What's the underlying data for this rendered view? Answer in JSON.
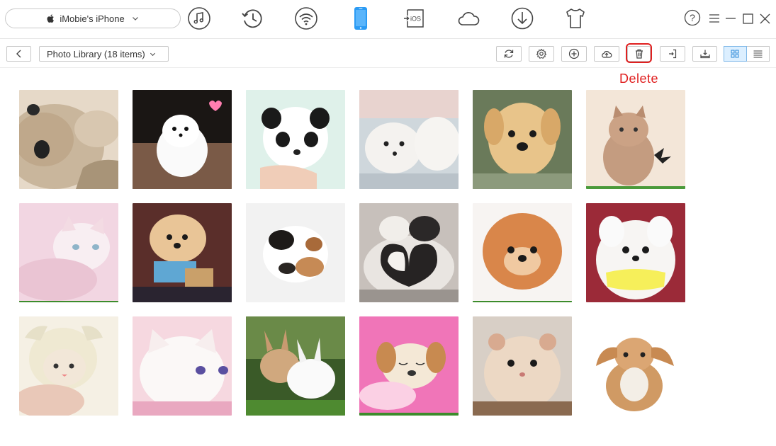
{
  "device": {
    "name": "iMobie's iPhone"
  },
  "nav": [
    {
      "id": "music",
      "icon": "music-icon"
    },
    {
      "id": "history",
      "icon": "history-icon"
    },
    {
      "id": "wifi",
      "icon": "wifi-icon"
    },
    {
      "id": "phone",
      "icon": "phone-icon",
      "active": true
    },
    {
      "id": "ios",
      "icon": "ios-transfer-icon",
      "label": "iOS"
    },
    {
      "id": "cloud",
      "icon": "cloud-icon"
    },
    {
      "id": "download",
      "icon": "download-icon"
    },
    {
      "id": "tshirt",
      "icon": "tshirt-icon"
    }
  ],
  "window": {
    "help": "?",
    "menu": "menu-icon",
    "minimize": "minimize-icon",
    "maximize": "maximize-icon",
    "close": "close-icon"
  },
  "toolbar": {
    "library_label": "Photo Library (18 items)",
    "delete_annotation": "Delete"
  },
  "colors": {
    "accent": "#2b9bf4",
    "highlight": "#e02020",
    "annotation": "#e01e1e"
  },
  "photos": [
    {
      "subject": "kitten lying"
    },
    {
      "subject": "white pomeranian"
    },
    {
      "subject": "panda puppy"
    },
    {
      "subject": "white puppies"
    },
    {
      "subject": "golden puppy"
    },
    {
      "subject": "kitten with butterfly"
    },
    {
      "subject": "white kitten on pink"
    },
    {
      "subject": "pomeranian with sign"
    },
    {
      "subject": "curled calico kitten"
    },
    {
      "subject": "two cats heart"
    },
    {
      "subject": "orange pomeranian"
    },
    {
      "subject": "white dog yellow shirt"
    },
    {
      "subject": "kitten in hood"
    },
    {
      "subject": "fluffy white kitten"
    },
    {
      "subject": "bunnies on grass"
    },
    {
      "subject": "sleeping puppy pink"
    },
    {
      "subject": "hamster"
    },
    {
      "subject": "lop bunny"
    }
  ]
}
